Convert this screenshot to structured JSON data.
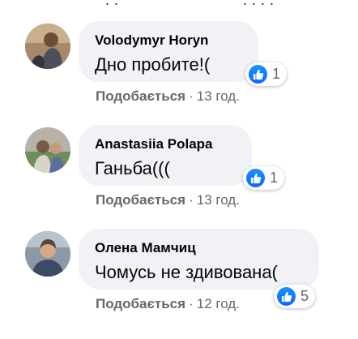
{
  "comments": [
    {
      "author": "Volodymyr Horyn",
      "text": "Дно пробите!(",
      "reaction_count": "1",
      "like_label": "Подобається",
      "separator": "·",
      "time": "13 год."
    },
    {
      "author": "Anastasiia Polapa",
      "text": "Ганьба(((",
      "reaction_count": "1",
      "like_label": "Подобається",
      "separator": "·",
      "time": "13 год."
    },
    {
      "author": "Олена Мамчиц",
      "text": "Чомусь не здивована(",
      "reaction_count": "5",
      "like_label": "Подобається",
      "separator": "·",
      "time": "12 год."
    }
  ],
  "colors": {
    "bubble": "#f0f2f5",
    "like_blue": "#0866ff",
    "meta_text": "#65676b",
    "text": "#050505"
  },
  "icons": {
    "reaction": "thumbs-up-icon"
  }
}
